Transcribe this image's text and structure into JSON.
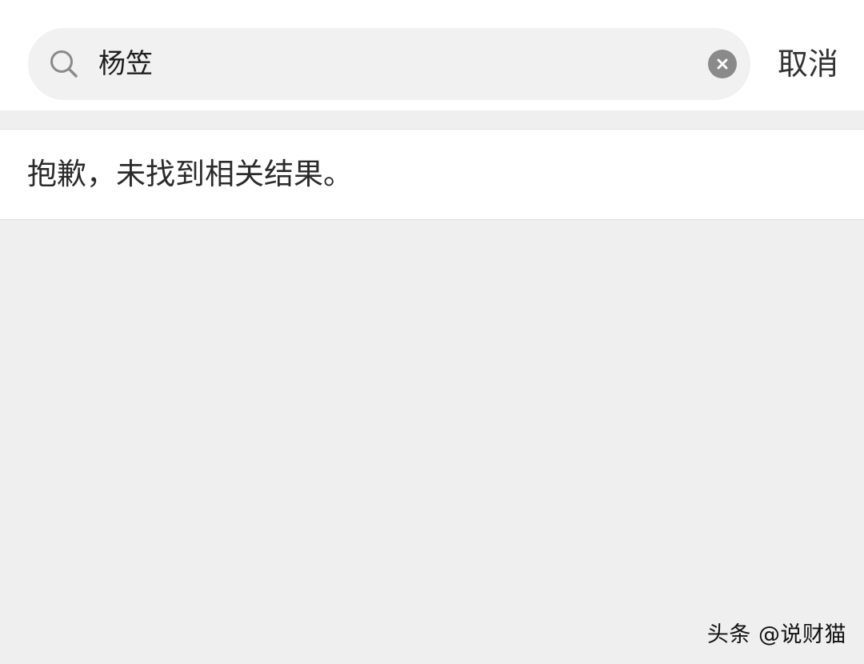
{
  "search": {
    "value": "杨笠",
    "cancel_label": "取消"
  },
  "results": {
    "empty_message": "抱歉，未找到相关结果。"
  },
  "watermark": {
    "text": "头条 @说财猫"
  },
  "colors": {
    "page_background": "#efefef",
    "header_background": "#ffffff",
    "search_background": "#f1f1f1",
    "icon_gray": "#8a8a8a",
    "text_dark": "#2b2b2b"
  }
}
